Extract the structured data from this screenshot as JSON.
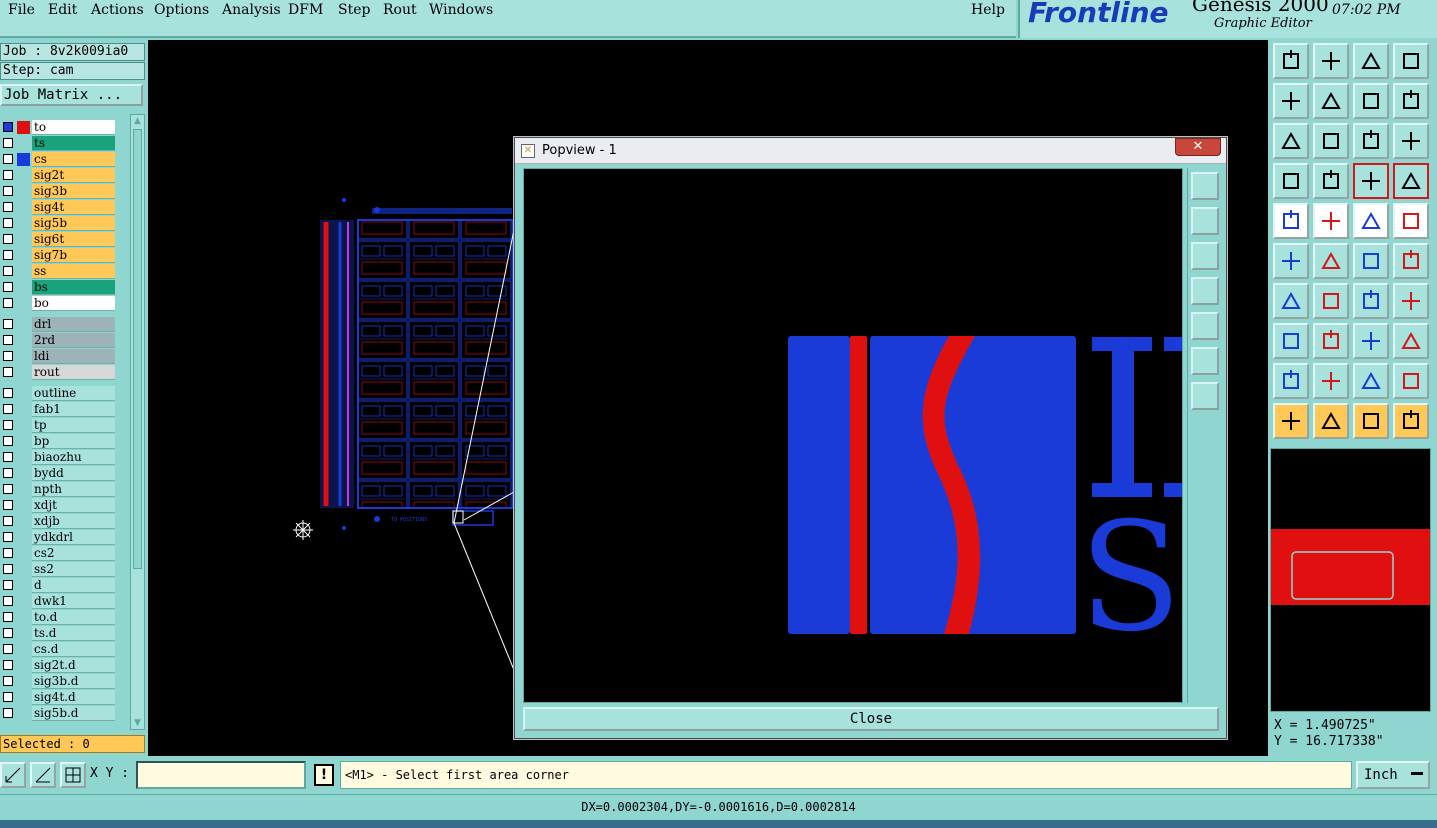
{
  "menu": {
    "file": "File",
    "edit": "Edit",
    "actions": "Actions",
    "options": "Options",
    "analysis": "Analysis",
    "dfm": "DFM",
    "step": "Step",
    "rout": "Rout",
    "windows": "Windows",
    "help": "Help"
  },
  "brand": {
    "logo": "Frontline",
    "product": "Genesis 2000",
    "subtitle": "Graphic Editor",
    "clock": "07:02 PM"
  },
  "job": {
    "job_label": "Job : 8v2k009ia0",
    "step_label": "Step: cam",
    "matrix_button": "Job Matrix ..."
  },
  "layers": [
    {
      "name": "to",
      "color": "#ffffff",
      "swatch": "#e01010"
    },
    {
      "name": "ts",
      "color": "#1aa37a",
      "swatch": ""
    },
    {
      "name": "cs",
      "color": "#ffc857",
      "swatch": "#1b3bd8"
    },
    {
      "name": "sig2t",
      "color": "#ffc857",
      "swatch": ""
    },
    {
      "name": "sig3b",
      "color": "#ffc857",
      "swatch": ""
    },
    {
      "name": "sig4t",
      "color": "#ffc857",
      "swatch": ""
    },
    {
      "name": "sig5b",
      "color": "#ffc857",
      "swatch": ""
    },
    {
      "name": "sig6t",
      "color": "#ffc857",
      "swatch": ""
    },
    {
      "name": "sig7b",
      "color": "#ffc857",
      "swatch": ""
    },
    {
      "name": "ss",
      "color": "#ffc857",
      "swatch": ""
    },
    {
      "name": "bs",
      "color": "#1aa37a",
      "swatch": ""
    },
    {
      "name": "bo",
      "color": "#ffffff",
      "swatch": ""
    },
    {
      "name": "drl",
      "color": "#9db3b8",
      "swatch": ""
    },
    {
      "name": "2rd",
      "color": "#9db3b8",
      "swatch": ""
    },
    {
      "name": "ldi",
      "color": "#9db3b8",
      "swatch": ""
    },
    {
      "name": "rout",
      "color": "#d7d7d7",
      "swatch": ""
    },
    {
      "name": "outline",
      "color": "#a8e2dd",
      "swatch": ""
    },
    {
      "name": "fab1",
      "color": "#a8e2dd",
      "swatch": ""
    },
    {
      "name": "tp",
      "color": "#a8e2dd",
      "swatch": ""
    },
    {
      "name": "bp",
      "color": "#a8e2dd",
      "swatch": ""
    },
    {
      "name": "biaozhu",
      "color": "#a8e2dd",
      "swatch": ""
    },
    {
      "name": "bydd",
      "color": "#a8e2dd",
      "swatch": ""
    },
    {
      "name": "npth",
      "color": "#a8e2dd",
      "swatch": ""
    },
    {
      "name": "xdjt",
      "color": "#a8e2dd",
      "swatch": ""
    },
    {
      "name": "xdjb",
      "color": "#a8e2dd",
      "swatch": ""
    },
    {
      "name": "ydkdrl",
      "color": "#a8e2dd",
      "swatch": ""
    },
    {
      "name": "cs2",
      "color": "#a8e2dd",
      "swatch": ""
    },
    {
      "name": "ss2",
      "color": "#a8e2dd",
      "swatch": ""
    },
    {
      "name": "d",
      "color": "#a8e2dd",
      "swatch": ""
    },
    {
      "name": "dwk1",
      "color": "#a8e2dd",
      "swatch": ""
    },
    {
      "name": "to.d",
      "color": "#a8e2dd",
      "swatch": ""
    },
    {
      "name": "ts.d",
      "color": "#a8e2dd",
      "swatch": ""
    },
    {
      "name": "cs.d",
      "color": "#a8e2dd",
      "swatch": ""
    },
    {
      "name": "sig2t.d",
      "color": "#a8e2dd",
      "swatch": ""
    },
    {
      "name": "sig3b.d",
      "color": "#a8e2dd",
      "swatch": ""
    },
    {
      "name": "sig4t.d",
      "color": "#a8e2dd",
      "swatch": ""
    },
    {
      "name": "sig5b.d",
      "color": "#a8e2dd",
      "swatch": ""
    }
  ],
  "selected": "Selected : 0",
  "popview": {
    "title": "Popview - 1",
    "close_label": "Close"
  },
  "canvas_text": {
    "to_positions": "TO POSITIONS"
  },
  "coords": {
    "x": "X = 1.490725\"",
    "y": "Y = 16.717338\""
  },
  "bottom": {
    "xy_label": "X Y :",
    "xy_value": "",
    "exclaim": "!",
    "prompt": "<M1> - Select first area corner",
    "units": "Inch"
  },
  "status": "DX=0.0002304,DY=-0.0001616,D=0.0002814",
  "colors": {
    "bg": "#8fd5d0",
    "panel": "#a8e2dd",
    "layer_blue": "#1b3bd8",
    "layer_red": "#e01010",
    "orange": "#ffc857"
  }
}
